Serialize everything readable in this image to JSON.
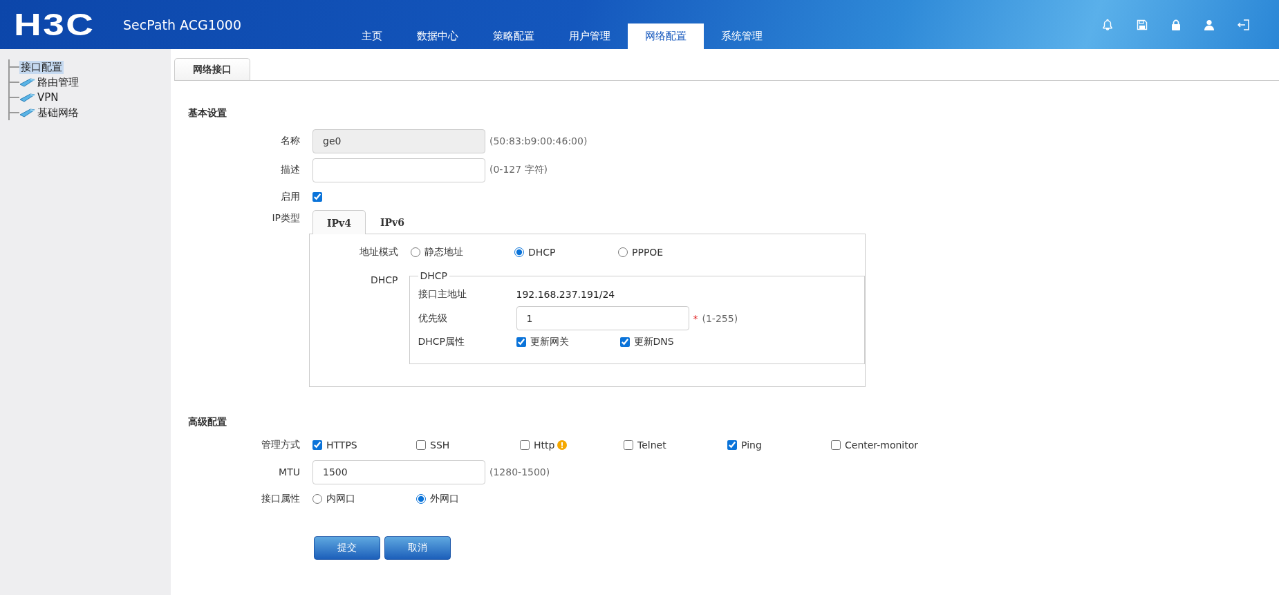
{
  "header": {
    "logo": "H3C",
    "product": "SecPath ACG1000",
    "nav": [
      {
        "label": "主页",
        "selected": false
      },
      {
        "label": "数据中心",
        "selected": false
      },
      {
        "label": "策略配置",
        "selected": false
      },
      {
        "label": "用户管理",
        "selected": false
      },
      {
        "label": "网络配置",
        "selected": true
      },
      {
        "label": "系统管理",
        "selected": false
      }
    ],
    "tools": [
      {
        "kind": "bell"
      },
      {
        "kind": "save"
      },
      {
        "kind": "lock"
      },
      {
        "kind": "user"
      },
      {
        "kind": "logout"
      }
    ]
  },
  "sidebar": {
    "items": [
      {
        "label": "接口配置",
        "kind": "page",
        "selected": true
      },
      {
        "label": "路由管理",
        "kind": "folder",
        "selected": false
      },
      {
        "label": "VPN",
        "kind": "folder",
        "selected": false
      },
      {
        "label": "基础网络",
        "kind": "folder",
        "selected": false
      }
    ]
  },
  "page_tabs": [
    {
      "label": "网络接口",
      "selected": true
    }
  ],
  "basic": {
    "title": "基本设置",
    "name": {
      "label": "名称",
      "value": "ge0",
      "disabled": true,
      "hint": "(50:83:b9:00:46:00)"
    },
    "description": {
      "label": "描述",
      "hint": "(0-127 字符)"
    },
    "enable": {
      "label": "启用",
      "checked": true
    },
    "ip_type": {
      "label": "IP类型",
      "tabs": [
        {
          "label": "IPv4",
          "selected": true
        },
        {
          "label": "IPv6",
          "selected": false
        }
      ],
      "address_mode": {
        "label": "地址模式",
        "options": [
          {
            "label": "静态地址",
            "selected": false
          },
          {
            "label": "DHCP",
            "selected": true
          },
          {
            "label": "PPPOE",
            "selected": false
          }
        ]
      },
      "dhcp": {
        "label": "DHCP",
        "legend": "DHCP",
        "address": {
          "label": "接口主地址",
          "value": "192.168.237.191/24"
        },
        "priority": {
          "label": "优先级",
          "value": "1",
          "required": "*",
          "hint": "(1-255)"
        },
        "attributes": {
          "label": "DHCP属性",
          "options": [
            {
              "label": "更新网关",
              "checked": true
            },
            {
              "label": "更新DNS",
              "checked": true
            }
          ]
        }
      }
    }
  },
  "advanced": {
    "title": "高级配置",
    "management": {
      "label": "管理方式",
      "options": [
        {
          "label": "HTTPS",
          "checked": true,
          "warning": false
        },
        {
          "label": "SSH",
          "checked": false,
          "warning": false
        },
        {
          "label": "Http",
          "checked": false,
          "warning": true
        },
        {
          "label": "Telnet",
          "checked": false,
          "warning": false
        },
        {
          "label": "Ping",
          "checked": true,
          "warning": false
        },
        {
          "label": "Center-monitor",
          "checked": false,
          "warning": false
        }
      ]
    },
    "mtu": {
      "label": "MTU",
      "value": "1500",
      "hint": "(1280-1500)"
    },
    "port_attribute": {
      "label": "接口属性",
      "options": [
        {
          "label": "内网口",
          "selected": false
        },
        {
          "label": "外网口",
          "selected": true
        }
      ]
    }
  },
  "buttons": [
    {
      "label": "提交"
    },
    {
      "label": "取消"
    }
  ]
}
